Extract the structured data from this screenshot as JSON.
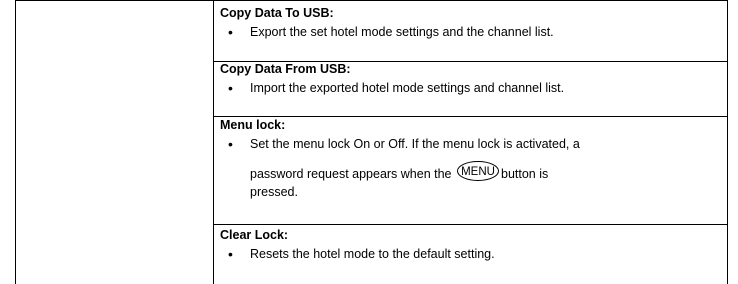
{
  "sections": [
    {
      "heading": "Copy Data To USB:",
      "bullet": "Export the set hotel mode settings and the channel list."
    },
    {
      "heading": "Copy Data From USB:",
      "bullet": "Import the exported hotel mode settings and channel list."
    },
    {
      "heading": "Menu lock:",
      "bullet_line1": "Set the menu lock On or Off. If the menu lock is activated, a",
      "bullet_line2_before": "password request appears when the",
      "button_label": "MENU",
      "bullet_line2_after": "button is",
      "bullet_line3": "pressed."
    },
    {
      "heading": "Clear Lock:",
      "bullet": "Resets the hotel mode to the default setting."
    }
  ],
  "bullet_glyph": "•"
}
